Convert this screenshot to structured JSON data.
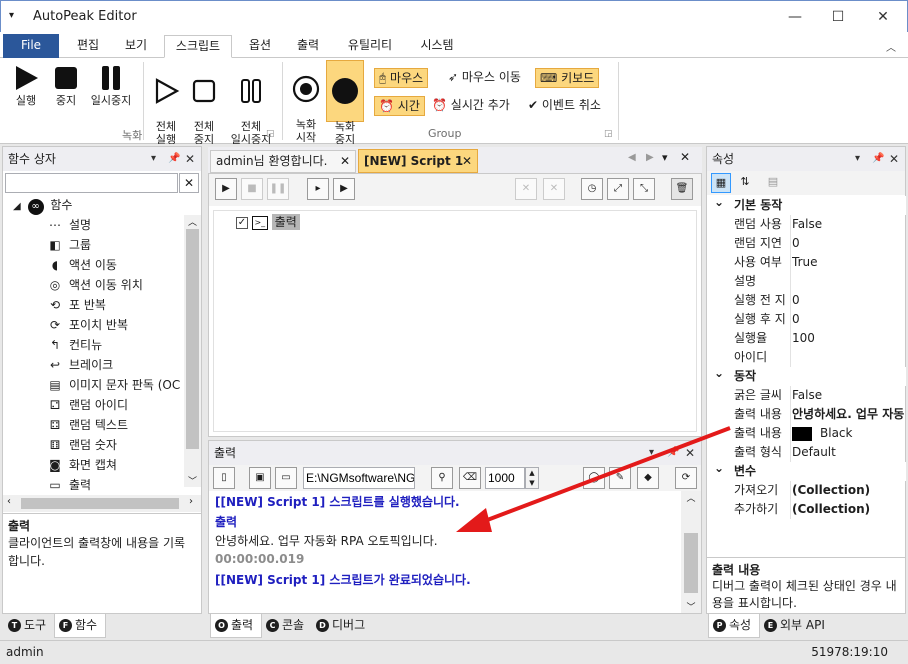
{
  "app": {
    "title": "AutoPeak Editor",
    "sysmenu": "▾"
  },
  "window_buttons": {
    "minimize": "—",
    "maximize": "☐",
    "close": "✕"
  },
  "ribbon_tabs": [
    "File",
    "편집",
    "보기",
    "스크립트",
    "옵션",
    "출력",
    "유틸리티",
    "시스템"
  ],
  "ribbon": {
    "record_group": {
      "label": "녹화",
      "run": "실행",
      "stop": "중지",
      "pause": "일시중지",
      "run_all": "전체\n실행",
      "stop_all": "전체\n중지",
      "pause_all": "전체\n일시중지"
    },
    "group": {
      "label": "Group",
      "rec_start": "녹화\n시작",
      "rec_stop": "녹화\n중지",
      "mouse": "마우스",
      "mouse_move": "마우스 이동",
      "keyboard": "키보드",
      "time": "시간",
      "realtime_add": "실시간 추가",
      "event_cancel": "이벤트 취소"
    }
  },
  "function_box": {
    "title": "함수 상자",
    "search_placeholder": "",
    "root": "함수",
    "items": [
      {
        "label": "설명",
        "icon": "ellipsis-circle-icon",
        "glyph": "⋯"
      },
      {
        "label": "그룹",
        "icon": "group-icon",
        "glyph": "◧"
      },
      {
        "label": "액션 이동",
        "icon": "action-move-icon",
        "glyph": "◖"
      },
      {
        "label": "액션 이동 위치",
        "icon": "target-icon",
        "glyph": "◎"
      },
      {
        "label": "포 반복",
        "icon": "loop-icon",
        "glyph": "⟲"
      },
      {
        "label": "포이치 반복",
        "icon": "foreach-icon",
        "glyph": "⟳"
      },
      {
        "label": "컨티뉴",
        "icon": "continue-icon",
        "glyph": "↰"
      },
      {
        "label": "브레이크",
        "icon": "break-icon",
        "glyph": "↩"
      },
      {
        "label": "이미지 문자 판독 (OC",
        "icon": "ocr-icon",
        "glyph": "▤"
      },
      {
        "label": "랜덤 아이디",
        "icon": "random-id-icon",
        "glyph": "⚁"
      },
      {
        "label": "랜덤 텍스트",
        "icon": "random-text-icon",
        "glyph": "⚃"
      },
      {
        "label": "랜덤 숫자",
        "icon": "random-number-icon",
        "glyph": "⚅"
      },
      {
        "label": "화면 캡쳐",
        "icon": "screen-capture-icon",
        "glyph": "◙"
      },
      {
        "label": "출력",
        "icon": "console-output-icon",
        "glyph": "▭"
      }
    ],
    "desc_title": "출력",
    "desc_text": "클라이언트의 출력창에 내용을 기록합니다.",
    "bottom_tabs": [
      {
        "badge": "T",
        "label": "도구"
      },
      {
        "badge": "F",
        "label": "함수"
      }
    ]
  },
  "editor": {
    "tabs": [
      {
        "label": "admin님 환영합니다."
      },
      {
        "label": "[NEW] Script 1"
      }
    ],
    "node_label": "출력"
  },
  "output": {
    "title": "출력",
    "path_value": "E:\\NGMsoftware\\NG",
    "number_value": "1000",
    "lines": [
      {
        "text": "[[NEW] Script 1] 스크립트를 실행했습니다.",
        "color": "#1f1fbf",
        "bold": true
      },
      {
        "text": "출력",
        "color": "#1f1fbf",
        "bold": true
      },
      {
        "text": "안녕하세요. 업무 자동화 RPA 오토픽입니다.",
        "color": "#1e1e1e",
        "bold": false
      },
      {
        "text": "00:00:00.019",
        "color": "#8c8c8c",
        "bold": true
      },
      {
        "text": "[[NEW] Script 1] 스크립트가 완료되었습니다.",
        "color": "#1f1fbf",
        "bold": true
      }
    ],
    "bottom_tabs": [
      {
        "badge": "O",
        "label": "출력"
      },
      {
        "badge": "C",
        "label": "콘솔"
      },
      {
        "badge": "D",
        "label": "디버그"
      }
    ]
  },
  "properties": {
    "title": "속성",
    "categories": [
      {
        "name": "기본 동작",
        "rows": [
          {
            "key": "랜덤 사용",
            "value": "False"
          },
          {
            "key": "랜덤 지연",
            "value": "0"
          },
          {
            "key": "사용 여부",
            "value": "True"
          },
          {
            "key": "설명",
            "value": ""
          },
          {
            "key": "실행 전 지",
            "value": "0"
          },
          {
            "key": "실행 후 지",
            "value": "0"
          },
          {
            "key": "실행율",
            "value": "100"
          },
          {
            "key": "아이디",
            "value": ""
          }
        ]
      },
      {
        "name": "동작",
        "rows": [
          {
            "key": "굵은 글씨",
            "value": "False"
          },
          {
            "key": "출력 내용",
            "value": "안녕하세요. 업무 자동"
          },
          {
            "key": "출력 내용",
            "value": "Black",
            "swatch": "#000000"
          },
          {
            "key": "출력 형식",
            "value": "Default"
          }
        ]
      },
      {
        "name": "변수",
        "rows": [
          {
            "key": "가져오기",
            "value": "(Collection)"
          },
          {
            "key": "추가하기",
            "value": "(Collection)"
          }
        ]
      }
    ],
    "desc_title": "출력 내용",
    "desc_text": "디버그 출력이 체크된 상태인 경우 내용을 표시합니다.",
    "bottom_tabs": [
      {
        "badge": "P",
        "label": "속성"
      },
      {
        "badge": "E",
        "label": "외부 API"
      }
    ]
  },
  "status": {
    "user": "admin",
    "time": "51978:19:10"
  },
  "colors": {
    "accent": "#2b579a",
    "highlight": "#fcd77e",
    "annotation_arrow": "#e31a1a"
  }
}
